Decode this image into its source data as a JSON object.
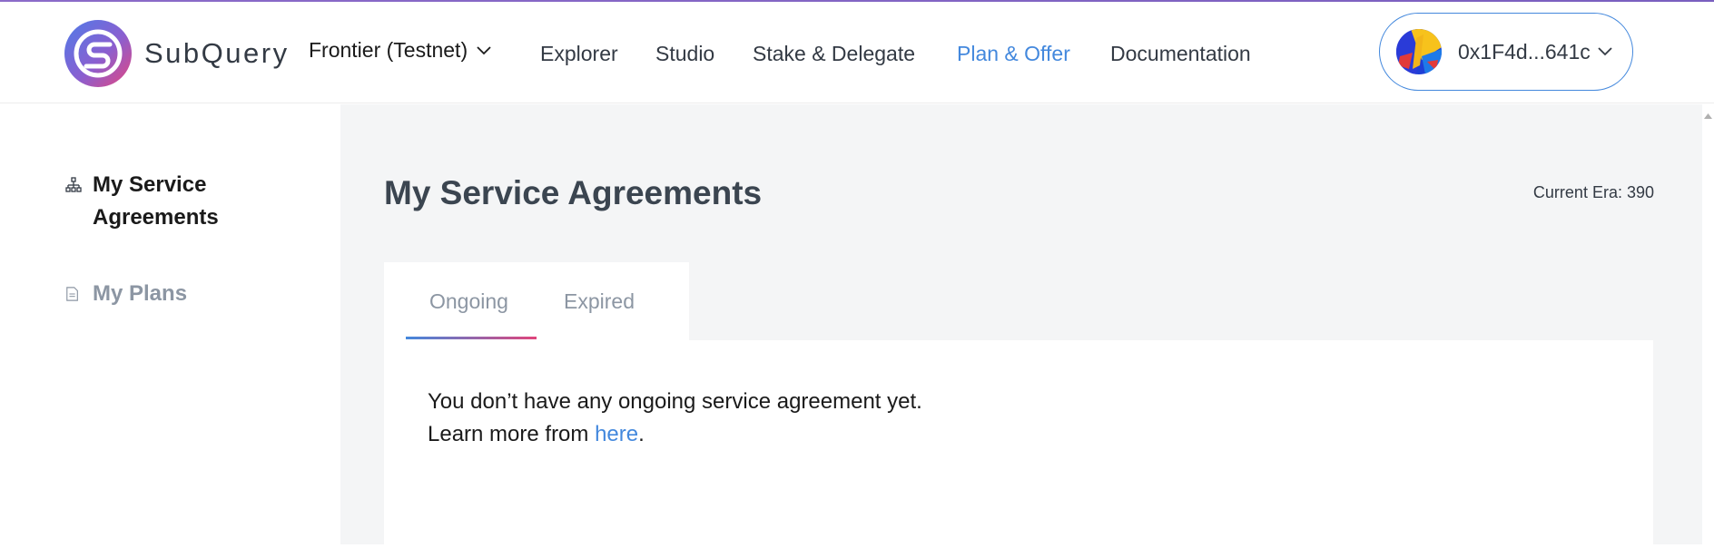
{
  "header": {
    "brand": "SubQuery",
    "network": "Frontier (Testnet)",
    "nav": [
      "Explorer",
      "Studio",
      "Stake & Delegate",
      "Plan & Offer",
      "Documentation"
    ],
    "active_nav": "Plan & Offer",
    "wallet_address": "0x1F4d...641c"
  },
  "sidebar": {
    "items": [
      {
        "label": "My Service Agreements",
        "icon": "hierarchy-icon",
        "active": true
      },
      {
        "label": "My Plans",
        "icon": "document-icon",
        "active": false
      }
    ]
  },
  "main": {
    "title": "My Service Agreements",
    "era_label": "Current Era: 390",
    "tabs": [
      "Ongoing",
      "Expired"
    ],
    "active_tab": "Ongoing",
    "empty_message_line1": "You don’t have any ongoing service agreement yet.",
    "empty_message_line2_prefix": "Learn more from ",
    "empty_message_link": "here",
    "empty_message_suffix": "."
  },
  "colors": {
    "accent": "#4388dd",
    "gradient_end": "#e0457b",
    "background": "#f4f5f6"
  }
}
